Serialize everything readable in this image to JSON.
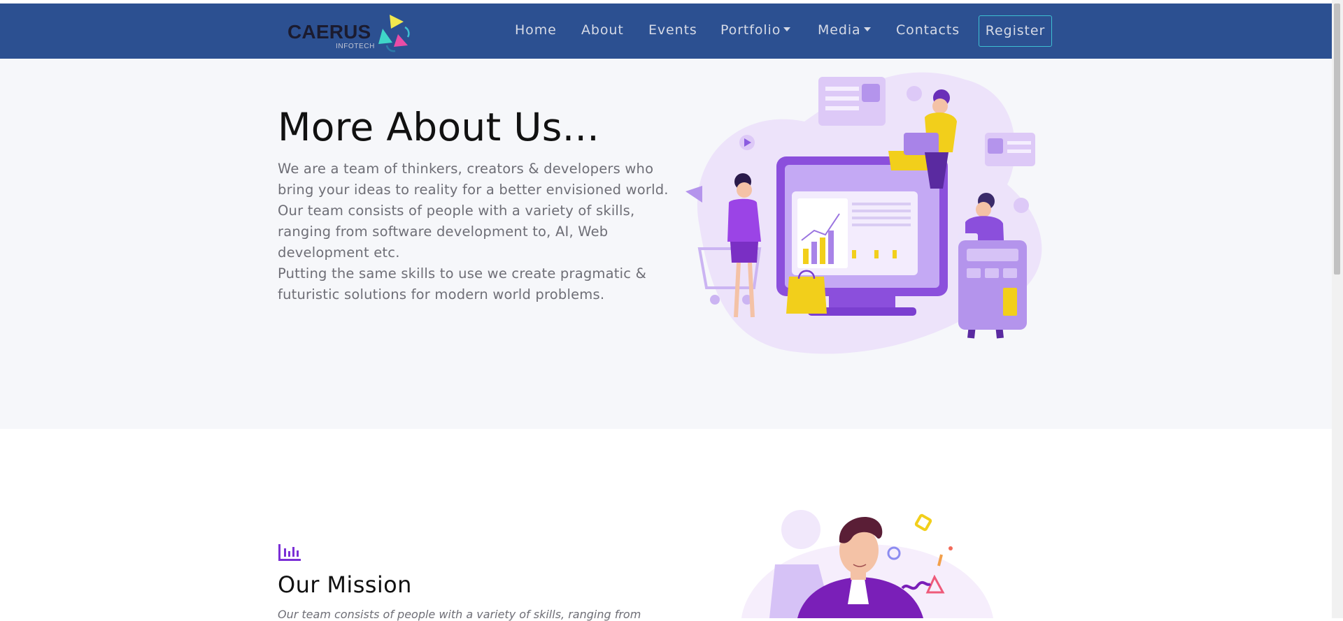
{
  "brand": {
    "name": "CAERUS",
    "sub": "INFOTECH"
  },
  "nav": {
    "home": "Home",
    "about": "About",
    "events": "Events",
    "portfolio": "Portfolio",
    "media": "Media",
    "contacts": "Contacts",
    "register": "Register"
  },
  "hero": {
    "title": "More About Us...",
    "paragraphs": [
      "We are a team of thinkers, creators & developers who bring your ideas to reality for a better envisioned world.",
      "Our team consists of people with a variety of skills, ranging from software development to, AI, Web development etc.",
      "Putting the same skills to use we create pragmatic & futuristic solutions for modern world problems."
    ]
  },
  "mission": {
    "title": "Our Mission",
    "text": "Our team consists of people with a variety of skills, ranging from"
  },
  "icons": {
    "dropdown": "caret-down-icon",
    "mission": "bar-chart-icon"
  },
  "colors": {
    "navbar": "#2c5091",
    "register_border": "#3ec0d2",
    "accent_purple": "#7b2fd6",
    "hero_background": "#f6f7fa"
  }
}
